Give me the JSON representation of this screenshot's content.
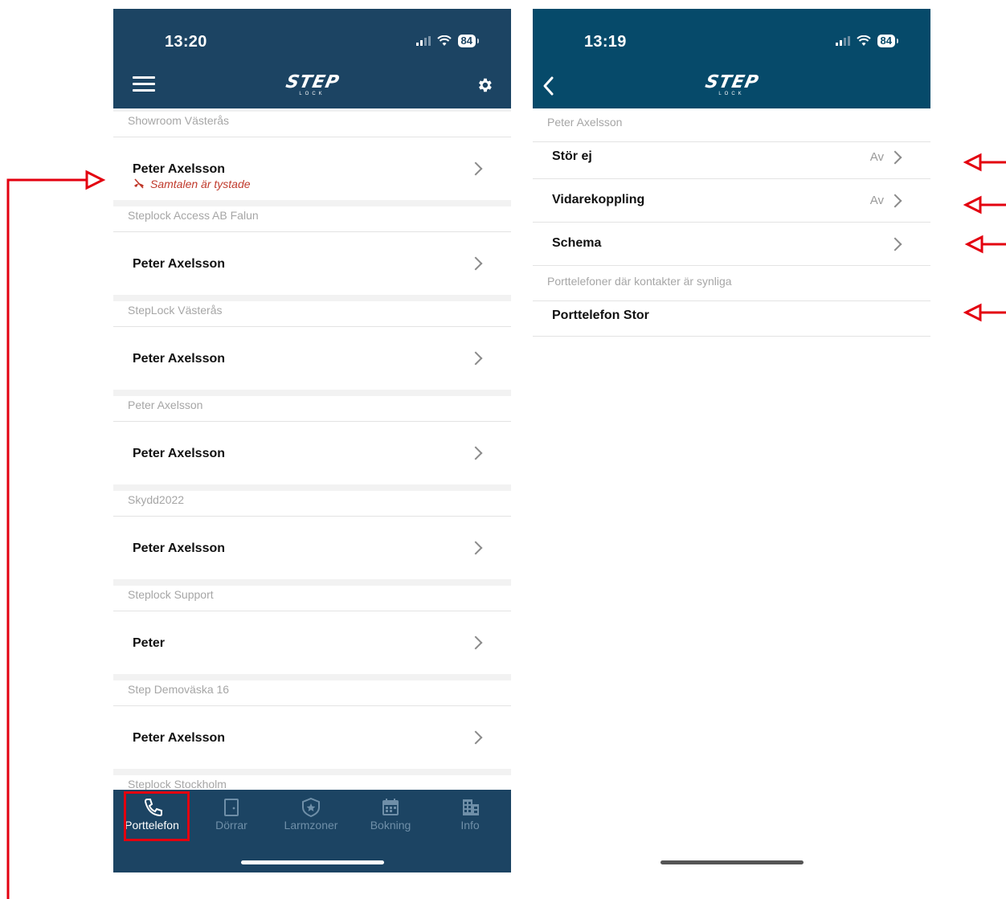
{
  "left_phone": {
    "status": {
      "time": "13:20",
      "battery": "84"
    },
    "logo": {
      "main": "STEP",
      "sub": "LOCK"
    },
    "sections": [
      {
        "label": "Showroom Västerås",
        "contact": "Peter Axelsson",
        "muted_text": "Samtalen är tystade"
      },
      {
        "label": "Steplock Access AB Falun",
        "contact": "Peter Axelsson"
      },
      {
        "label": "StepLock Västerås",
        "contact": "Peter Axelsson"
      },
      {
        "label": "Peter Axelsson",
        "contact": "Peter Axelsson"
      },
      {
        "label": "Skydd2022",
        "contact": "Peter Axelsson"
      },
      {
        "label": "Steplock Support",
        "contact": "Peter"
      },
      {
        "label": "Step Demoväska 16",
        "contact": "Peter Axelsson"
      },
      {
        "label": "Steplock Stockholm"
      }
    ],
    "tabs": [
      {
        "label": "Porttelefon",
        "icon": "phone-icon",
        "active": true
      },
      {
        "label": "Dörrar",
        "icon": "door-icon"
      },
      {
        "label": "Larmzoner",
        "icon": "shield-star-icon"
      },
      {
        "label": "Bokning",
        "icon": "calendar-icon"
      },
      {
        "label": "Info",
        "icon": "building-icon"
      }
    ]
  },
  "right_phone": {
    "status": {
      "time": "13:19",
      "battery": "84"
    },
    "logo": {
      "main": "STEP",
      "sub": "LOCK"
    },
    "section_label": "Peter Axelsson",
    "settings": [
      {
        "label": "Stör ej",
        "value": "Av"
      },
      {
        "label": "Vidarekoppling",
        "value": "Av"
      },
      {
        "label": "Schema",
        "value": ""
      }
    ],
    "visible_label": "Porttelefoner där kontakter är synliga",
    "door_phone": "Porttelefon Stor"
  },
  "colors": {
    "header_left": "#1c4463",
    "header_right": "#064a6a",
    "annotation": "#e3000f",
    "muted": "#c0392b"
  }
}
